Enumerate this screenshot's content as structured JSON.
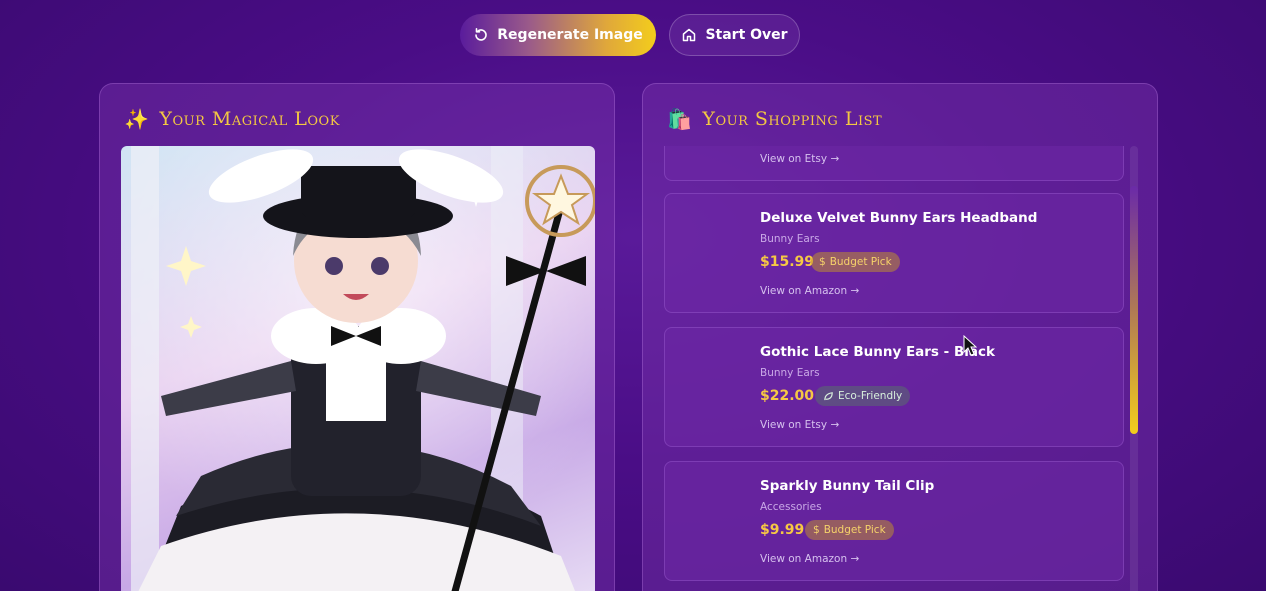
{
  "actions": {
    "regenerate_label": "Regenerate Image",
    "start_over_label": "Start Over"
  },
  "look_panel": {
    "emoji": "✨",
    "title": "Your Magical Look"
  },
  "shopping_panel": {
    "emoji": "🛍️",
    "title": "Your Shopping List",
    "items": [
      {
        "name": "",
        "category": "",
        "price": "",
        "badge": "",
        "badge_icon": "",
        "link": "View on Etsy →"
      },
      {
        "name": "Deluxe Velvet Bunny Ears Headband",
        "category": "Bunny Ears",
        "price": "$15.99",
        "badge": "Budget Pick",
        "badge_icon": "$",
        "link": "View on Amazon →"
      },
      {
        "name": "Gothic Lace Bunny Ears - Black",
        "category": "Bunny Ears",
        "price": "$22.00",
        "badge": "Eco-Friendly",
        "badge_icon": "leaf-icon",
        "link": "View on Etsy →"
      },
      {
        "name": "Sparkly Bunny Tail Clip",
        "category": "Accessories",
        "price": "$9.99",
        "badge": "Budget Pick",
        "badge_icon": "$",
        "link": "View on Amazon →"
      }
    ]
  },
  "colors": {
    "accent_gold": "#f3c742",
    "background": "#4a0d86",
    "panel": "#6e28a5"
  }
}
